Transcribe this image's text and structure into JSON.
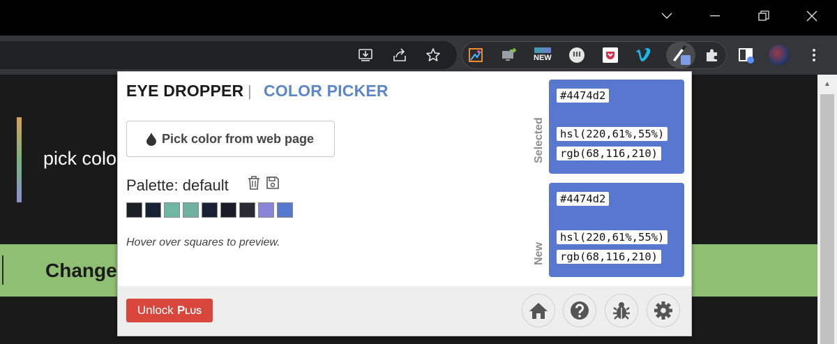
{
  "window_controls": {
    "dropdown_icon": "chevron-down-icon",
    "minimize_icon": "minimize-icon",
    "restore_icon": "restore-icon",
    "close_icon": "close-icon"
  },
  "toolbar": {
    "icons": [
      "install-icon",
      "share-icon",
      "star-icon"
    ],
    "extensions": [
      "color-picker-ext-icon",
      "screen-share-ext-icon",
      "news-ext-icon",
      "uu-ext-icon",
      "pocket-ext-icon",
      "vimeo-ext-icon",
      "eye-dropper-ext-icon",
      "extensions-puzzle-icon",
      "side-panel-icon",
      "profile-avatar"
    ],
    "news_badge": "NEW"
  },
  "background_page": {
    "text_line": "pick colo",
    "band_text": "Change"
  },
  "popup": {
    "tabs": {
      "eye_dropper": "EYE DROPPER",
      "separator": "|",
      "color_picker": "COLOR PICKER"
    },
    "pick_button_label": "Pick color from web page",
    "palette": {
      "title": "Palette: default",
      "swatches": [
        "#1b1f26",
        "#172234",
        "#6fb7a2",
        "#6fb1a0",
        "#172235",
        "#1a1c2a",
        "#2b2c33",
        "#8a84d6",
        "#5778cf"
      ],
      "hint": "Hover over squares to preview."
    },
    "selected": {
      "label": "Selected",
      "hex": "#4474d2",
      "hsl": "hsl(220,61%,55%)",
      "rgb": "rgb(68,116,210)"
    },
    "new": {
      "label": "New",
      "hex": "#4474d2",
      "hsl": "hsl(220,61%,55%)",
      "rgb": "rgb(68,116,210)"
    },
    "footer": {
      "unlock_label": "Unlock",
      "unlock_plus": "Plus",
      "buttons": [
        "home-icon",
        "help-icon",
        "bug-icon",
        "settings-icon"
      ]
    }
  },
  "colors": {
    "accent_blue": "#5b86c9",
    "swatch_fill": "#5878d0",
    "unlock_red": "#d9473c"
  }
}
